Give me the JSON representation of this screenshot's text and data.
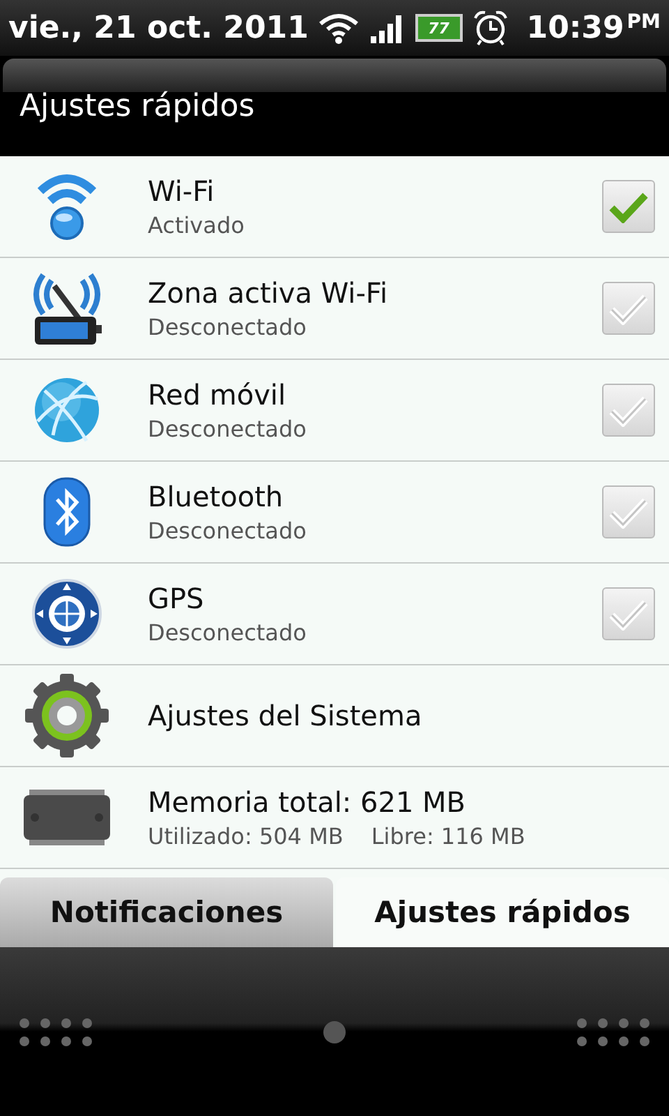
{
  "status_bar": {
    "date": "vie., 21 oct. 2011",
    "battery": "77",
    "time": "10:39",
    "ampm": "PM"
  },
  "panel": {
    "title": "Ajustes rápidos"
  },
  "items": [
    {
      "kind": "toggle",
      "title": "Wi-Fi",
      "subtitle": "Activado",
      "checked": true
    },
    {
      "kind": "toggle",
      "title": "Zona activa Wi-Fi",
      "subtitle": "Desconectado",
      "checked": false
    },
    {
      "kind": "toggle",
      "title": "Red móvil",
      "subtitle": "Desconectado",
      "checked": false
    },
    {
      "kind": "toggle",
      "title": "Bluetooth",
      "subtitle": "Desconectado",
      "checked": false
    },
    {
      "kind": "toggle",
      "title": "GPS",
      "subtitle": "Desconectado",
      "checked": false
    },
    {
      "kind": "link",
      "title": "Ajustes del Sistema"
    },
    {
      "kind": "memory",
      "title": "Memoria total: 621 MB",
      "used": "Utilizado: 504 MB",
      "free": "Libre: 116 MB"
    }
  ],
  "tabs": [
    {
      "label": "Notificaciones",
      "selected": false
    },
    {
      "label": "Ajustes rápidos",
      "selected": true
    }
  ]
}
